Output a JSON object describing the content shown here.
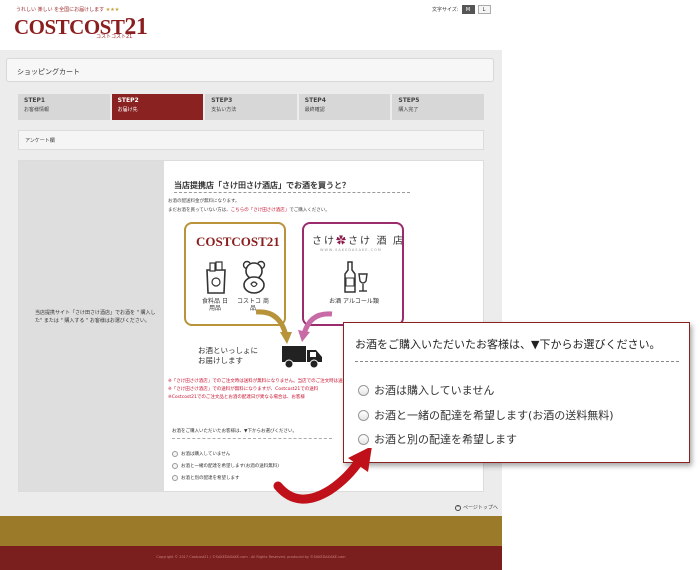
{
  "header": {
    "logo_tagline": "うれしい 楽しい を全国にお届けします",
    "logo_stars": "★★★",
    "logo_text": "COSTCOST",
    "logo_number": "21",
    "logo_subtext": "コストコスト21",
    "font_size_label": "文字サイズ:",
    "font_size_options": [
      "M",
      "L"
    ]
  },
  "cart": {
    "title": "ショッピングカート"
  },
  "steps": [
    {
      "num": "STEP1",
      "name": "お客様情報"
    },
    {
      "num": "STEP2",
      "name": "お届け先"
    },
    {
      "num": "STEP3",
      "name": "支払い方法"
    },
    {
      "num": "STEP4",
      "name": "最終確認"
    },
    {
      "num": "STEP5",
      "name": "購入完了"
    }
  ],
  "questionnaire": {
    "title": "アンケート欄",
    "label": "当店提携サイト「さけ田さけ酒店」でお酒を \" 購入した\" または \" 購入する \" お客様はお選びください。"
  },
  "info": {
    "heading": "当店提携店「さけ田さけ酒店」でお酒を買うと？",
    "note1": "お酒の配送料金が無料になります。",
    "note2_prefix": "まだお酒を買っていない方は、",
    "note2_link": "こちらの「さけ田さけ酒店」",
    "note2_suffix": "でご購入ください。",
    "cc_logo": "COSTCOST21",
    "cc_item1": "食料品 日用品",
    "cc_item2": "コストコ 商品",
    "sake_logo_a": "さけ",
    "sake_logo_b": "さけ 酒 店",
    "sake_url": "WWW.SAKEDASAKE.COM",
    "sake_item": "お酒 アルコール類",
    "deliver_line1": "お酒といっしょに",
    "deliver_line2": "お届けします",
    "red_note1": "※「さけ田さけ酒店」でのご注文時は送料が無料になりません。当店でのご注文時は送料を無料に変更いたします。",
    "red_note2": "※「さけ田さけ酒店」での送料が無料になりますが、Costcost21での送料",
    "red_note3": "※Costcost21でのご注文品とお酒の配達日が異なる場合は、お客様"
  },
  "question_small": "お酒をご購入いただいたお客様は、▼下からお選びください。",
  "options_small": [
    "お酒は購入していません",
    "お酒と一緒の配達を希望します(お酒の送料無料)",
    "お酒と別の配達を希望します"
  ],
  "pagetop": "ページトップへ",
  "footer": {
    "copyright": "Copyright © 2017 Costcost21 / ©SAKEDASAKE.com . All Rights Reserved. produced by ©SAKEDASAKE.com"
  },
  "callout": {
    "question": "お酒をご購入いただいたお客様は、▼下からお選びください。",
    "options": [
      "お酒は購入していません",
      "お酒と一緒の配達を希望します(お酒の送料無料)",
      "お酒と別の配達を希望します"
    ]
  },
  "colors": {
    "brand": "#8b1e1e",
    "gold": "#9b7a2a",
    "accent_link": "#c8102e",
    "callout_arrow": "#c0111a"
  }
}
